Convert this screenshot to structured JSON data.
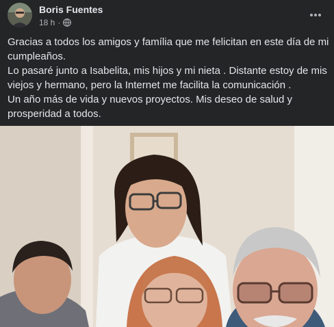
{
  "post": {
    "author": "Boris Fuentes",
    "time": "18 h",
    "separator": "·",
    "privacy_icon": "globe-icon",
    "more_icon": "more-horizontal-icon",
    "lines": [
      "Gracias a todos los amigos y família que me felicitan en este día de mi",
      "cumpleaños.",
      "Lo pasaré junto a Isabelita, mis hijos y mi nieta . Distante estoy de mis",
      "viejos y hermano,  pero la Internet me facilita la comunicación .",
      "Un año más de vida y nuevos proyectos. Mis deseo de salud y",
      "prosperidad a todos."
    ]
  },
  "colors": {
    "background": "#242526",
    "text_primary": "#e4e6eb",
    "text_secondary": "#b0b3b8"
  }
}
